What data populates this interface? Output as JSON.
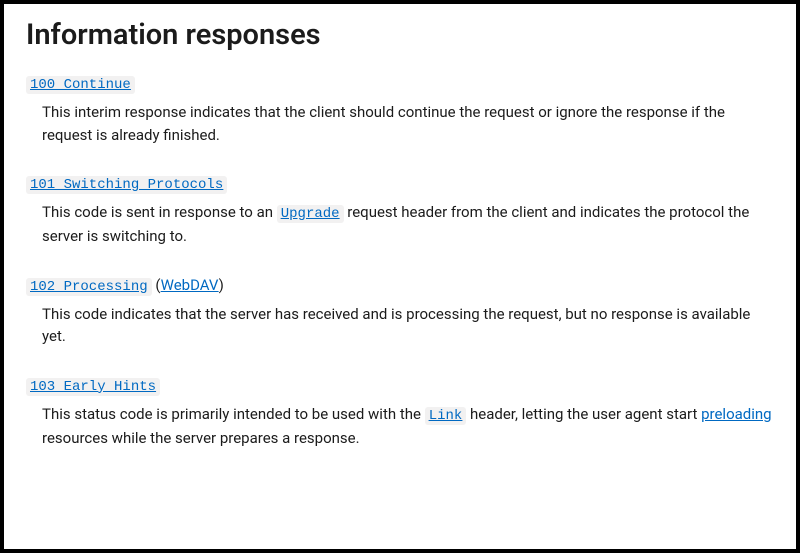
{
  "title": "Information responses",
  "items": [
    {
      "code": "100 Continue",
      "desc_parts": [
        {
          "text": "This interim response indicates that the client should continue the request or ignore the response if the request is already finished."
        }
      ]
    },
    {
      "code": "101 Switching Protocols",
      "desc_parts": [
        {
          "text": "This code is sent in response to an "
        },
        {
          "code_link": "Upgrade"
        },
        {
          "text": " request header from the client and indicates the protocol the server is switching to."
        }
      ]
    },
    {
      "code": "102 Processing",
      "deprecated": true,
      "suffix_link": "WebDAV",
      "desc_parts": [
        {
          "text": "This code indicates that the server has received and is processing the request, but no response is available yet."
        }
      ]
    },
    {
      "code": "103 Early Hints",
      "desc_parts": [
        {
          "text": "This status code is primarily intended to be used with the "
        },
        {
          "code_link": "Link"
        },
        {
          "text": " header, letting the user agent start "
        },
        {
          "text_link": "preloading"
        },
        {
          "text": " resources while the server prepares a response."
        }
      ]
    }
  ]
}
